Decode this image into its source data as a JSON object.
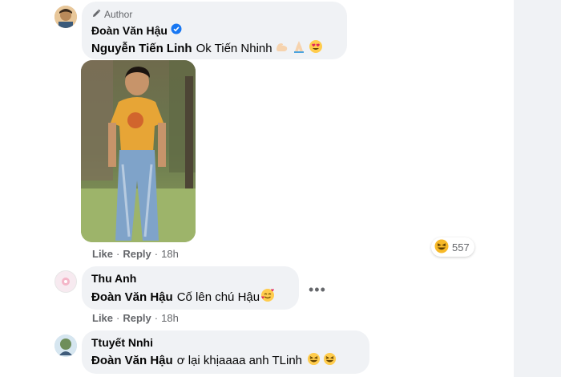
{
  "comment1": {
    "badge": "Author",
    "name": "Đoàn Văn Hậu",
    "mention": "Nguyễn Tiến Linh",
    "text": "Ok Tiến Nhinh",
    "actions": {
      "like": "Like",
      "reply": "Reply",
      "time": "18h"
    },
    "reaction_count": "557"
  },
  "comment2": {
    "name": "Thu Anh",
    "mention": "Đoàn Văn Hậu",
    "text": "Cố lên chú Hậu",
    "actions": {
      "like": "Like",
      "reply": "Reply",
      "time": "18h"
    }
  },
  "comment3": {
    "name": "Ttuyết Nnhi",
    "mention": "Đoàn Văn Hậu",
    "text": "ơ lại khịaaaa anh TLinh"
  },
  "icons": {
    "author_badge": "pencil-icon",
    "verified": "verified-badge-icon",
    "more": "more-options-icon",
    "reaction": "laughing-emoji-icon"
  },
  "colors": {
    "bubble": "#f0f2f5",
    "verified": "#1877f2",
    "secondary_text": "#65676b"
  }
}
